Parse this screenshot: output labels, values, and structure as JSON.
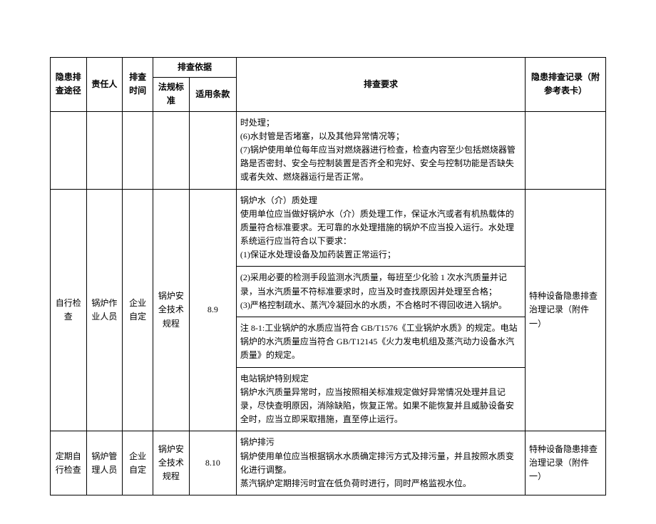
{
  "headers": {
    "route": "隐患排查途径",
    "person": "责任人",
    "time": "排查时间",
    "basis": "排查依据",
    "std": "法规标准",
    "clause": "适用条款",
    "requirement": "排查要求",
    "record": "隐患排查记录（附参考表卡）"
  },
  "row0": {
    "req": "时处理；\n(6)水封管是否堵塞，以及其他异常情况等；\n(7)锅炉使用单位每年应当对燃烧器进行检查，检查内容至少包括燃烧器管路是否密封、安全与控制装置是否齐全和完好、安全与控制功能是否缺失或者失效、燃烧器运行是否正常。"
  },
  "row1": {
    "route": "自行检查",
    "person": "锅炉作业人员",
    "time": "企业自定",
    "std": "锅炉安全技术规程",
    "clause": "8.9",
    "req_a": "锅炉水（介）质处理\n使用单位应当做好锅炉水（介）质处理工作，保证水汽或者有机热载体的质量符合标准要求。无可靠的水处理措施的锅炉不应当投入运行。水处理系统运行应当符合以下要求：\n(1)保证水处理设备及加药装置正常运行；",
    "req_b": "(2)采用必要的检测手段监测水汽质量，每班至少化验 1 次水汽质量并记录，当水汽质量不符标准要求时，应当及时查找原因并处理至合格；\n(3)严格控制疏水、蒸汽冷凝回水的水质，不合格时不得回收进入锅炉。",
    "req_c": "注 8-1:工业锅炉的水质应当符合 GB/T1576《工业锅炉水质》的规定。电站锅炉的水汽质量应当符合 GB/T12145《火力发电机组及蒸汽动力设备水汽质量》的规定。",
    "req_d": "电站锅炉特别规定\n锅炉水汽质量异常时，应当按照相关标准规定做好异常情况处理并且记录，尽快查明原因，消除缺陷，恢复正常。如果不能恢复并且威胁设备安全时，应当立即采取措施，直至停止运行。",
    "record": "特种设备隐患排查治理记录（附件一）"
  },
  "row2": {
    "route": "定期自行检查",
    "person": "锅炉管理人员",
    "time": "企业自定",
    "std": "锅炉安全技术规程",
    "clause": "8.10",
    "req": "锅炉排污\n锅炉使用单位应当根据锅水水质确定排污方式及排污量，并且按照水质变化进行调整。\n蒸汽锅炉定期排污时宜在低负荷时进行，同时严格监视水位。",
    "record": "特种设备隐患排查治理记录（附件一）"
  }
}
